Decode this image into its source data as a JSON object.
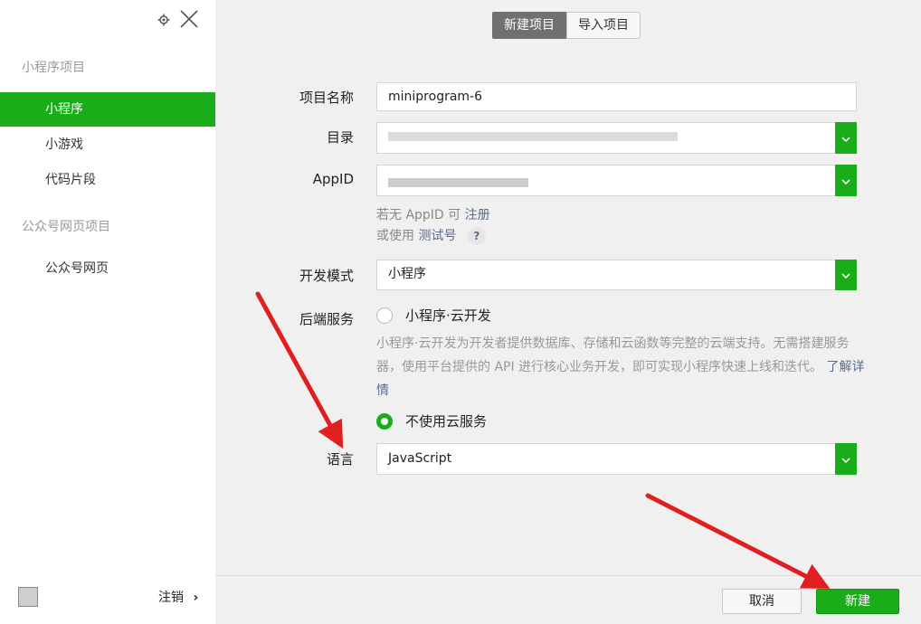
{
  "sidebar": {
    "groups": [
      {
        "title": "小程序项目",
        "items": [
          "小程序",
          "小游戏",
          "代码片段"
        ]
      },
      {
        "title": "公众号网页项目",
        "items": [
          "公众号网页"
        ]
      }
    ],
    "logout_label": "注销",
    "logout_chevron": "›"
  },
  "tabs": {
    "new_project": "新建项目",
    "import_project": "导入项目"
  },
  "form": {
    "project_name_label": "项目名称",
    "project_name_value": "miniprogram-6",
    "directory_label": "目录",
    "appid_label": "AppID",
    "appid_hint_prefix": "若无 AppID 可",
    "appid_hint_link": "注册",
    "test_hint_prefix": "或使用",
    "test_hint_link": "测试号",
    "test_hint_help": "?",
    "dev_mode_label": "开发模式",
    "dev_mode_value": "小程序",
    "backend_label": "后端服务",
    "cloud_option": "小程序·云开发",
    "cloud_desc": "小程序·云开发为开发者提供数据库、存储和云函数等完整的云端支持。无需搭建服务器，使用平台提供的 API 进行核心业务开发，即可实现小程序快速上线和迭代。",
    "cloud_desc_link": "了解详情",
    "no_cloud_option": "不使用云服务",
    "language_label": "语言",
    "language_value": "JavaScript"
  },
  "footer": {
    "cancel_label": "取消",
    "create_label": "新建"
  },
  "colors": {
    "accent": "#1aad19",
    "link": "#576b95",
    "annotation": "#e02020"
  }
}
